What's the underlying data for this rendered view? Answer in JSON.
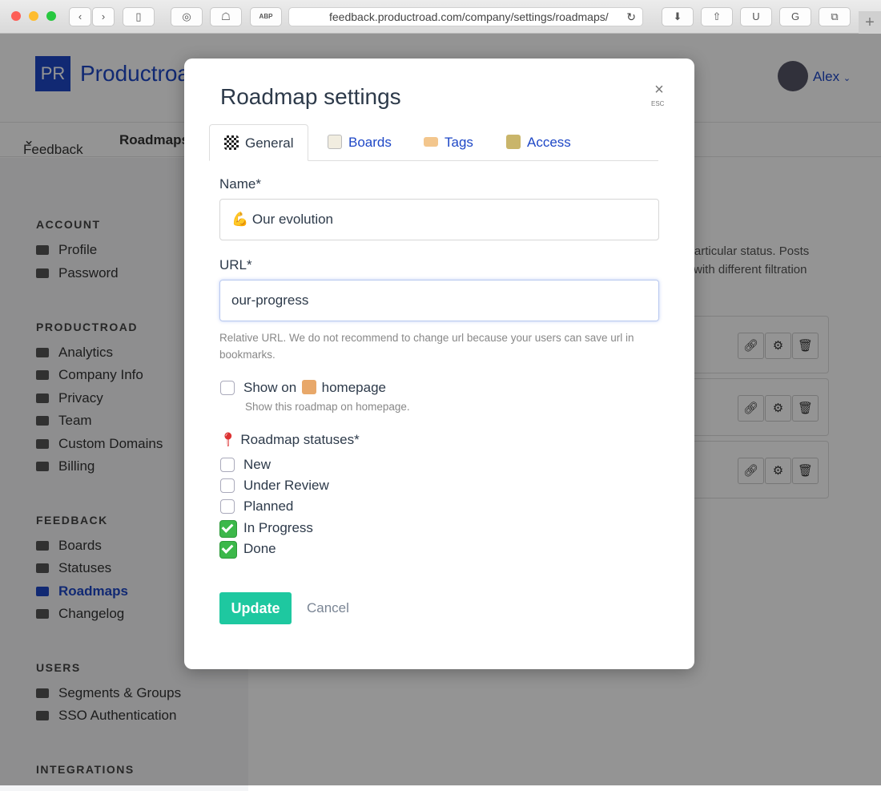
{
  "browser": {
    "url": "feedback.productroad.com/company/settings/roadmaps/",
    "buttons": [
      "back",
      "forward",
      "sidebar",
      "1password",
      "ghostery",
      "adblock",
      "downloads",
      "share",
      "ublock",
      "grammarly",
      "tabs",
      "new-tab"
    ],
    "adblock_label": "ABP",
    "plus": "+"
  },
  "app": {
    "logo": "PR",
    "brand": "Productroad",
    "user": "Alex",
    "nav": [
      "Feedback",
      "Roadmaps"
    ]
  },
  "sidebar": {
    "sections": [
      {
        "title": "ACCOUNT",
        "items": [
          "Profile",
          "Password"
        ]
      },
      {
        "title": "PRODUCTROAD",
        "items": [
          "Analytics",
          "Company Info",
          "Privacy",
          "Team",
          "Custom Domains",
          "Billing"
        ]
      },
      {
        "title": "FEEDBACK",
        "items": [
          "Boards",
          "Statuses",
          "Roadmaps",
          "Changelog"
        ]
      },
      {
        "title": "USERS",
        "items": [
          "Segments & Groups",
          "SSO Authentication"
        ]
      },
      {
        "title": "INTEGRATIONS",
        "items": []
      }
    ],
    "active": "Roadmaps"
  },
  "background": {
    "text1": "n particular status. Posts",
    "text2": "ps with different filtration"
  },
  "modal": {
    "title": "Roadmap settings",
    "close": "×",
    "esc": "ESC",
    "tabs": [
      {
        "label": "General",
        "icon": "checkered-flag-icon"
      },
      {
        "label": "Boards",
        "icon": "memo-icon"
      },
      {
        "label": "Tags",
        "icon": "tag-icon"
      },
      {
        "label": "Access",
        "icon": "lock-icon"
      }
    ],
    "name_label": "Name*",
    "name_value": "💪 Our evolution",
    "url_label": "URL*",
    "url_value": "our-progress",
    "url_help": "Relative URL. We do not recommend to change url because your users can save url in bookmarks.",
    "homepage_label_pre": "Show on",
    "homepage_label_post": "homepage",
    "homepage_checked": false,
    "homepage_help": "Show this roadmap on homepage.",
    "statuses_label": "Roadmap statuses*",
    "statuses": [
      {
        "label": "New",
        "checked": false
      },
      {
        "label": "Under Review",
        "checked": false
      },
      {
        "label": "Planned",
        "checked": false
      },
      {
        "label": "In Progress",
        "checked": true
      },
      {
        "label": "Done",
        "checked": true
      }
    ],
    "update": "Update",
    "cancel": "Cancel"
  },
  "colors": {
    "brand": "#1e47c6",
    "primary_button": "#1ec8a0",
    "checked": "#3cb84a"
  }
}
